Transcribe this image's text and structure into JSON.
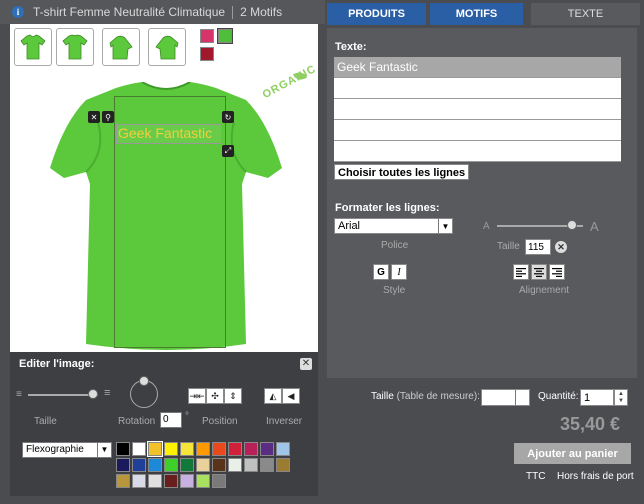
{
  "header": {
    "info_icon": "i",
    "product_name": "T-shirt Femme Neutralité Climatique",
    "motif_count": "2 Motifs"
  },
  "tabs": [
    {
      "label": "PRODUITS"
    },
    {
      "label": "MOTIFS"
    },
    {
      "label": "TEXTE"
    }
  ],
  "preview": {
    "organic_badge": "ORGANIC",
    "design_text": "Geek Fantastic",
    "shirt_color": "#5cc83b",
    "product_colors": [
      "#d8346c",
      "#4fbe3a",
      "#a0182c"
    ]
  },
  "edit_image": {
    "title": "Editer l'image:",
    "close_glyph": "✕",
    "size_label": "Taille",
    "rotation_label": "Rotation",
    "rotation_value": "0",
    "rotation_unit": "°",
    "position_label": "Position",
    "invert_label": "Inverser",
    "print_method": "Flexographie",
    "palette": [
      "#000000",
      "#ffffff",
      "#f2c22a",
      "#fff200",
      "#f5e43a",
      "#ff9900",
      "#e8491d",
      "#d0203a",
      "#b8205a",
      "#5b2c83",
      "#9fc5e8",
      "#1a1a5c",
      "#1f3f99",
      "#1c8ad8",
      "#3ecf2a",
      "#117a3a",
      "#e8d19a",
      "#5a3418",
      "#e8f0e8",
      "#c0c0c0",
      "#8a8a8a",
      "#9c7c33",
      "#b8963c",
      "#d9d9e8",
      "#e0e0e0",
      "#6a1f1f",
      "#c8b0e0",
      "#a8e060",
      "#7a7a7a"
    ],
    "selected_color": "#f2c22a"
  },
  "text_panel": {
    "title": "Texte:",
    "lines": [
      "Geek Fantastic",
      "",
      "",
      "",
      ""
    ],
    "choose_all": "Choisir toutes les lignes",
    "format_title": "Formater les lignes:",
    "font_value": "Arial",
    "font_label": "Police",
    "size_small_a": "A",
    "size_big_a": "A",
    "size_label": "Taille",
    "size_value": "115",
    "clear_glyph": "✕",
    "style_label": "Style",
    "bold_glyph": "G",
    "italic_glyph": "I",
    "align_label": "Alignement"
  },
  "order": {
    "size_label": "Taille",
    "size_chart": "(Table de mesure):",
    "quantity_label": "Quantité:",
    "quantity_value": "1",
    "price": "35,40 €",
    "add_to_cart": "Ajouter au panier",
    "ttc": "TTC",
    "shipping": "Hors frais de port"
  }
}
